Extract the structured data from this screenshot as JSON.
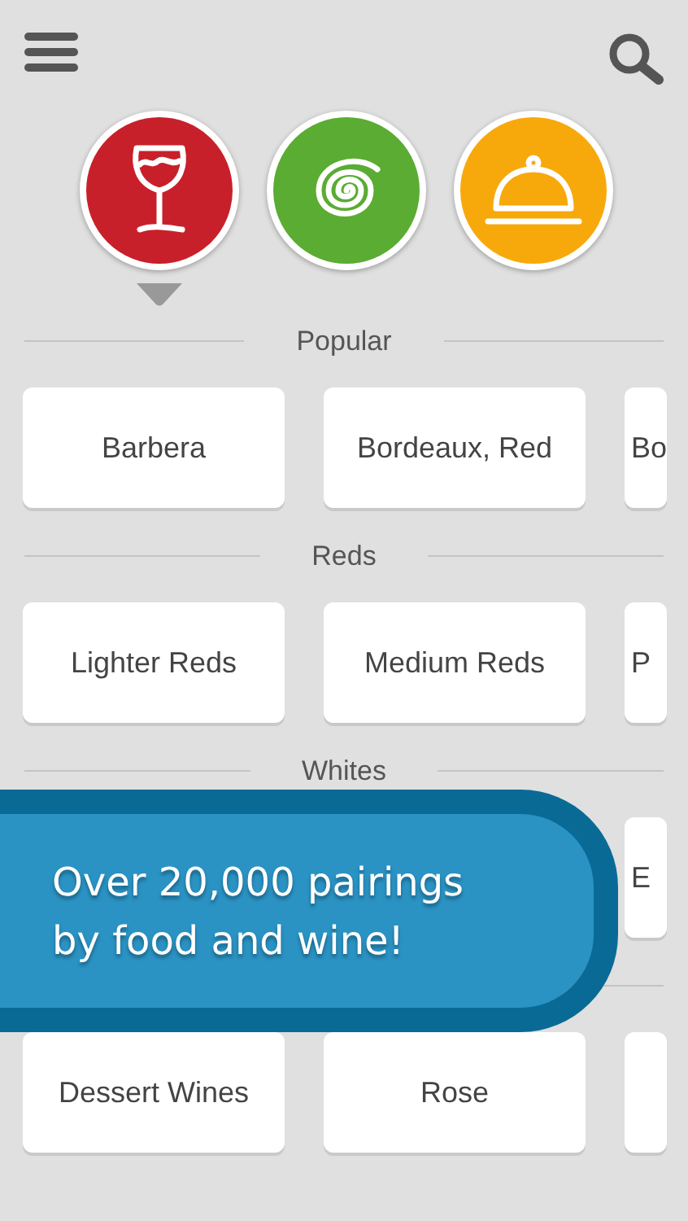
{
  "categories": [
    {
      "kind": "wine",
      "color": "#c8202a",
      "selected": true
    },
    {
      "kind": "spiral",
      "color": "#5aac32",
      "selected": false
    },
    {
      "kind": "food",
      "color": "#f7a90c",
      "selected": false
    }
  ],
  "sections": [
    {
      "label": "Popular",
      "cards": [
        {
          "kind": "text",
          "label": "Barbera"
        },
        {
          "kind": "text",
          "label": "Bordeaux, Red"
        },
        {
          "kind": "text",
          "label": "Bo"
        }
      ]
    },
    {
      "label": "Reds",
      "cards": [
        {
          "kind": "text",
          "label": "Lighter Reds"
        },
        {
          "kind": "text",
          "label": "Medium Reds"
        },
        {
          "kind": "text",
          "label": "P"
        }
      ]
    },
    {
      "label": "Whites",
      "cards": [
        {
          "kind": "covered"
        },
        {
          "kind": "covered"
        },
        {
          "kind": "text",
          "label": "E"
        }
      ]
    },
    {
      "cards": [
        {
          "kind": "text",
          "label": "Dessert Wines"
        },
        {
          "kind": "text",
          "label": "Rose"
        },
        {
          "kind": "blank"
        }
      ]
    }
  ],
  "banner": {
    "lines": [
      "Over 20,000 pairings",
      "by food and wine!"
    ]
  }
}
